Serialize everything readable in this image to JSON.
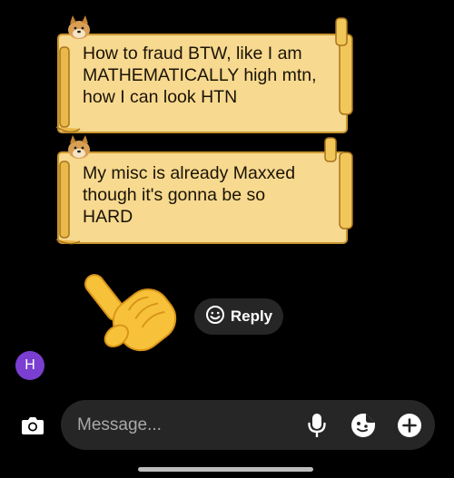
{
  "messages": [
    {
      "lines": [
        "How to fraud BTW, like I am",
        "MATHEMATICALLY high mtn,",
        "how I can look HTN"
      ]
    },
    {
      "lines": [
        "My misc is already Maxxed",
        "though it's gonna be so",
        "HARD"
      ]
    }
  ],
  "reply": {
    "label": "Reply",
    "icon": "smiley-icon"
  },
  "pointing_emoji": "👆",
  "avatar": {
    "initial": "H",
    "color": "#7a3fd1"
  },
  "composer": {
    "placeholder": "Message...",
    "icons": [
      "camera-icon",
      "microphone-icon",
      "sticker-icon",
      "plus-icon"
    ]
  },
  "colors": {
    "background": "#000000",
    "bubble_parchment": "#f7d98f",
    "bubble_border": "#c9962e",
    "composer_bg": "#262626"
  }
}
